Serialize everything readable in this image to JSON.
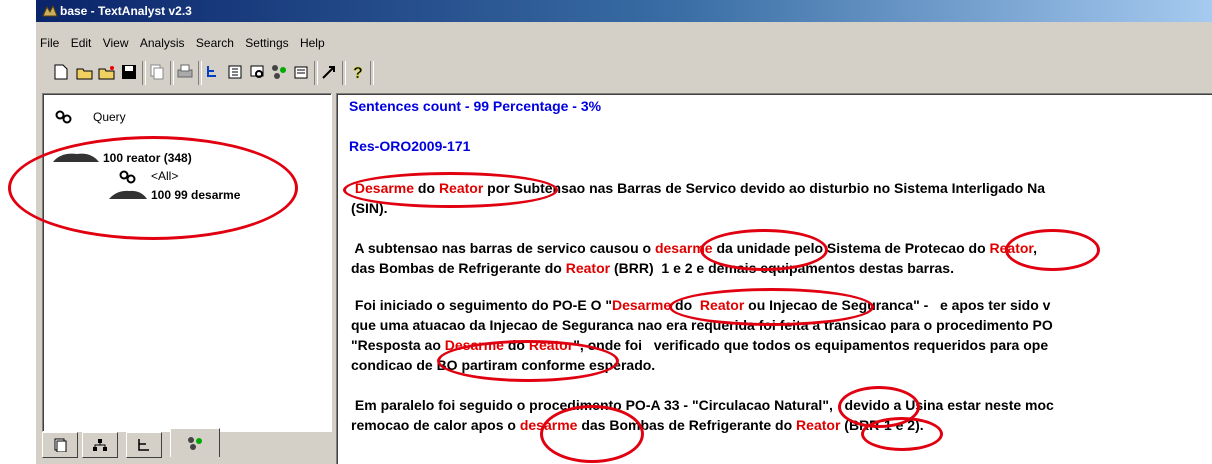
{
  "window": {
    "title": "base - TextAnalyst v2.3"
  },
  "menu": [
    "File",
    "Edit",
    "View",
    "Analysis",
    "Search",
    "Settings",
    "Help"
  ],
  "toolbar": {
    "icons": [
      "new-icon",
      "open-icon",
      "open-special-icon",
      "save-icon",
      "copy-icon",
      "print-icon",
      "tree-icon",
      "index-icon",
      "search-text-icon",
      "semantic-net-icon",
      "export-icon",
      "cursor-icon",
      "help-icon"
    ]
  },
  "tree": {
    "query_label": "Query",
    "root_label": "100 reator (348)",
    "all_label": "<All>",
    "child_label": "100 99 desarme"
  },
  "content": {
    "stats": "Sentences count - 99  Percentage - 3%",
    "doc_id": "Res-ORO2009-171",
    "p1": [
      [
        [
          " ",
          0
        ],
        [
          "Desarme",
          1
        ],
        [
          " do ",
          0
        ],
        [
          "Reator",
          1
        ],
        [
          " por Subtensao nas Barras de Servico devido ao disturbio no Sistema Interligado Na",
          0
        ]
      ],
      [
        [
          "(SIN).",
          0
        ]
      ]
    ],
    "p2": [
      [
        [
          " A subtensao nas barras de servico causou o ",
          0
        ],
        [
          "desarme",
          1
        ],
        [
          " da unidade pelo Sistema de Protecao do ",
          0
        ],
        [
          "Reator",
          1
        ],
        [
          ", ",
          0
        ]
      ],
      [
        [
          "das Bombas de Refrigerante do ",
          0
        ],
        [
          "Reator",
          1
        ],
        [
          " (BRR)  1 e 2 e demais equipamentos destas barras.",
          0
        ]
      ]
    ],
    "p3": [
      [
        [
          " Foi iniciado o seguimento do PO-E O \"",
          0
        ],
        [
          "Desarme",
          1
        ],
        [
          " do  ",
          0
        ],
        [
          "Reator",
          1
        ],
        [
          " ou Injecao de Seguranca\" -   e apos ter sido v",
          0
        ]
      ],
      [
        [
          "que uma atuacao da Injecao de Seguranca nao era requerida foi feita a transicao para o procedimento PO",
          0
        ]
      ],
      [
        [
          "\"Resposta ao ",
          0
        ],
        [
          "Desarme",
          1
        ],
        [
          " do ",
          0
        ],
        [
          "Reator",
          1
        ],
        [
          "\", onde foi   verificado que todos os equipamentos requeridos para ope",
          0
        ]
      ],
      [
        [
          "condicao de BO partiram conforme esperado.",
          0
        ]
      ]
    ],
    "p4": [
      [
        [
          " Em paralelo foi seguido o procedimento PO-A 33 - \"Circulacao Natural\",   devido a Usina estar neste moc",
          0
        ]
      ],
      [
        [
          "remocao de calor apos o ",
          0
        ],
        [
          "desarme",
          1
        ],
        [
          " das Bombas de Refrigerante do ",
          0
        ],
        [
          "Reator",
          1
        ],
        [
          " (BRR-1 e 2).",
          0
        ]
      ]
    ]
  },
  "colors": {
    "highlight": "#e00000",
    "header": "#0000e0",
    "annotation": "#e00010"
  }
}
